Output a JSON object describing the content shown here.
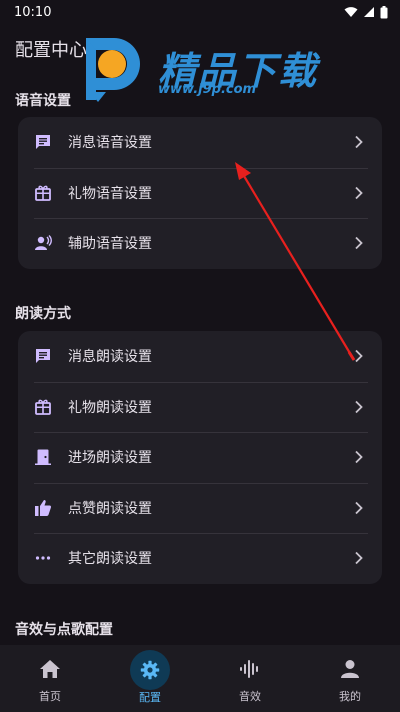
{
  "status_bar": {
    "time": "10:10"
  },
  "header": {
    "title": "配置中心"
  },
  "watermark": {
    "brand": "精品下载",
    "url": "www.j9p.com"
  },
  "sections": [
    {
      "title": "语音设置",
      "items": [
        {
          "icon": "message-icon",
          "label": "消息语音设置"
        },
        {
          "icon": "gift-icon",
          "label": "礼物语音设置"
        },
        {
          "icon": "voice-icon",
          "label": "辅助语音设置"
        }
      ]
    },
    {
      "title": "朗读方式",
      "items": [
        {
          "icon": "message-icon",
          "label": "消息朗读设置"
        },
        {
          "icon": "gift-icon",
          "label": "礼物朗读设置"
        },
        {
          "icon": "door-icon",
          "label": "进场朗读设置"
        },
        {
          "icon": "thumbs-up-icon",
          "label": "点赞朗读设置"
        },
        {
          "icon": "more-icon",
          "label": "其它朗读设置"
        }
      ]
    },
    {
      "title": "音效与点歌配置"
    }
  ],
  "bottom_nav": [
    {
      "icon": "home-icon",
      "label": "首页",
      "active": false
    },
    {
      "icon": "settings-icon",
      "label": "配置",
      "active": true
    },
    {
      "icon": "waveform-icon",
      "label": "音效",
      "active": false
    },
    {
      "icon": "person-icon",
      "label": "我的",
      "active": false
    }
  ],
  "colors": {
    "background": "#151218",
    "card": "#211f26",
    "icon_accent": "#d0bcff",
    "nav_active": "#5ab8f5",
    "arrow_annotation": "#e8201e"
  }
}
